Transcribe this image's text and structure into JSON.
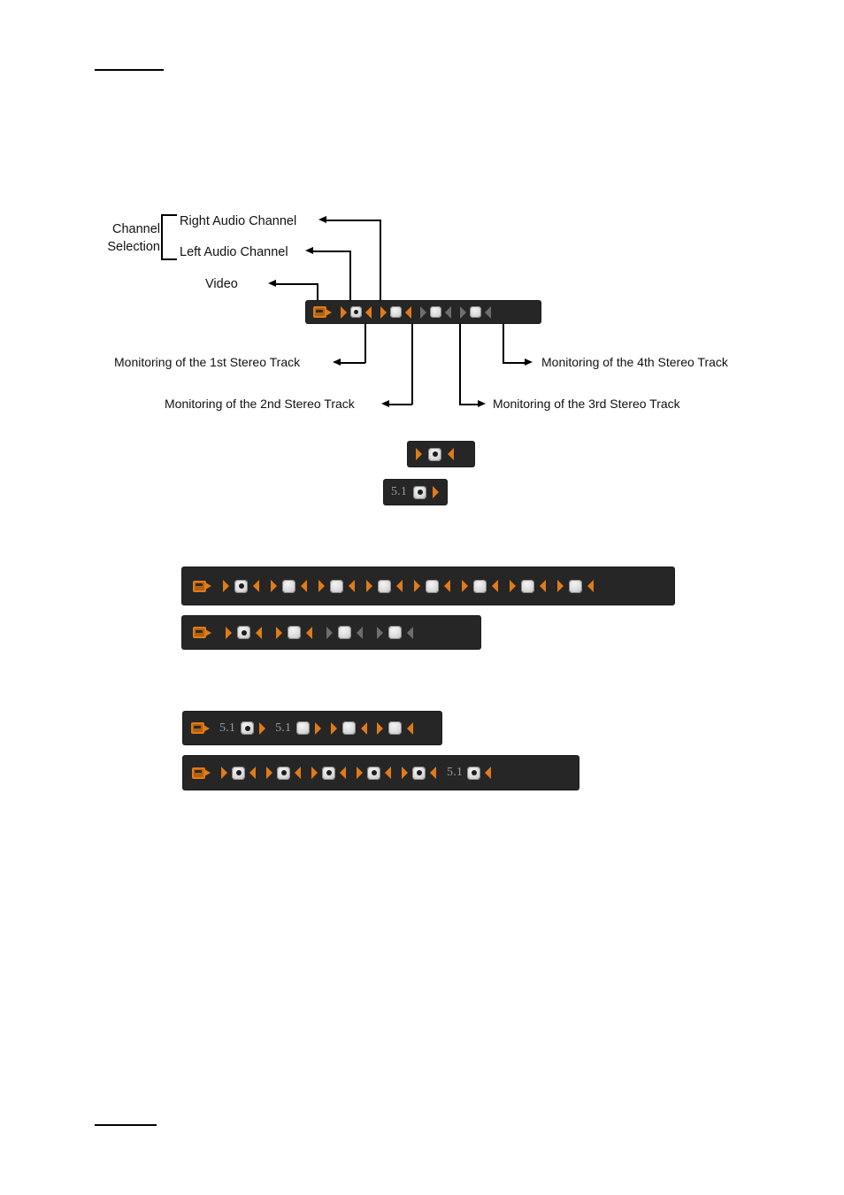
{
  "document": {
    "header_rule": true,
    "footer_rule": true
  },
  "colors": {
    "toolbar_bg": "#262626",
    "accent_orange": "#E07B18",
    "inactive_gray": "#6e6e6e",
    "button_light": "#d9d9d9",
    "text": "#111111",
    "label_gray": "#9a9a9a"
  },
  "diagram": {
    "callouts": {
      "channel_selection": "Channel\nSelection",
      "channel_selection_line1": "Channel",
      "channel_selection_line2": "Selection",
      "right_audio_channel": "Right Audio Channel",
      "left_audio_channel": "Left Audio Channel",
      "video": "Video",
      "track1": "Monitoring of the 1st Stereo Track",
      "track2": "Monitoring of the 2nd Stereo Track",
      "track3": "Monitoring of the 3rd Stereo Track",
      "track4": "Monitoring of the 4th Stereo Track"
    },
    "icons": {
      "video": "camcorder-icon",
      "left_channel": "speaker-left-icon",
      "right_channel": "speaker-right-icon",
      "monitor_button": "monitor-toggle-button"
    }
  },
  "toolbars": {
    "annotated": {
      "name": "annotated-audio-monitoring-toolbar",
      "video_icon": true,
      "groups": [
        {
          "label": null,
          "left": "on",
          "button": "active",
          "right": "on"
        },
        {
          "label": null,
          "left": "on",
          "button": "idle",
          "right": "on"
        },
        {
          "label": null,
          "left": "off",
          "button": "idle",
          "right": "off"
        },
        {
          "label": null,
          "left": "off",
          "button": "idle",
          "right": "off"
        }
      ]
    },
    "sample_stereo": {
      "name": "single-stereo-group-sample",
      "video_icon": false,
      "groups": [
        {
          "label": null,
          "left": "on",
          "button": "active",
          "right": "on"
        }
      ]
    },
    "sample_51": {
      "name": "single-51-group-sample",
      "video_icon": false,
      "groups": [
        {
          "label": "5.1",
          "left": null,
          "button": "active",
          "right": null,
          "trailing_left": "on"
        }
      ]
    },
    "eight_track": {
      "name": "eight-stereo-track-toolbar",
      "video_icon": true,
      "groups": [
        {
          "label": null,
          "left": "on",
          "button": "active",
          "right": "on"
        },
        {
          "label": null,
          "left": "on",
          "button": "idle",
          "right": "on"
        },
        {
          "label": null,
          "left": "on",
          "button": "idle",
          "right": "on"
        },
        {
          "label": null,
          "left": "on",
          "button": "idle",
          "right": "on"
        },
        {
          "label": null,
          "left": "on",
          "button": "idle",
          "right": "on"
        },
        {
          "label": null,
          "left": "on",
          "button": "idle",
          "right": "on"
        },
        {
          "label": null,
          "left": "on",
          "button": "idle",
          "right": "on"
        },
        {
          "label": null,
          "left": "on",
          "button": "idle",
          "right": "on"
        }
      ]
    },
    "four_track": {
      "name": "four-stereo-track-toolbar",
      "video_icon": true,
      "groups": [
        {
          "label": null,
          "left": "on",
          "button": "active",
          "right": "on"
        },
        {
          "label": null,
          "left": "on",
          "button": "idle",
          "right": "on"
        },
        {
          "label": null,
          "left": "off",
          "button": "idle",
          "right": "off"
        },
        {
          "label": null,
          "left": "off",
          "button": "idle",
          "right": "off"
        }
      ]
    },
    "mixed_51_first": {
      "name": "51-and-stereo-toolbar",
      "video_icon": true,
      "groups": [
        {
          "label": "5.1",
          "left": null,
          "button": "active",
          "right": null,
          "trailing_left": "on"
        },
        {
          "label": "5.1",
          "left": null,
          "button": "idle",
          "right": null,
          "trailing_left": "on"
        },
        {
          "label": null,
          "left": "on",
          "button": "idle",
          "right": "on"
        },
        {
          "label": null,
          "left": "on",
          "button": "idle",
          "right": "on"
        }
      ]
    },
    "mixed_51_last": {
      "name": "stereo-and-51-toolbar",
      "video_icon": true,
      "groups": [
        {
          "label": null,
          "left": "on",
          "button": "active",
          "right": "on"
        },
        {
          "label": null,
          "left": "on",
          "button": "active",
          "right": "on"
        },
        {
          "label": null,
          "left": "on",
          "button": "active",
          "right": "on"
        },
        {
          "label": null,
          "left": "on",
          "button": "active",
          "right": "on"
        },
        {
          "label": null,
          "left": "on",
          "button": "active",
          "right": "on"
        },
        {
          "label": "5.1",
          "left": null,
          "button": "active",
          "right": null,
          "trailing_right": "on"
        }
      ]
    }
  }
}
